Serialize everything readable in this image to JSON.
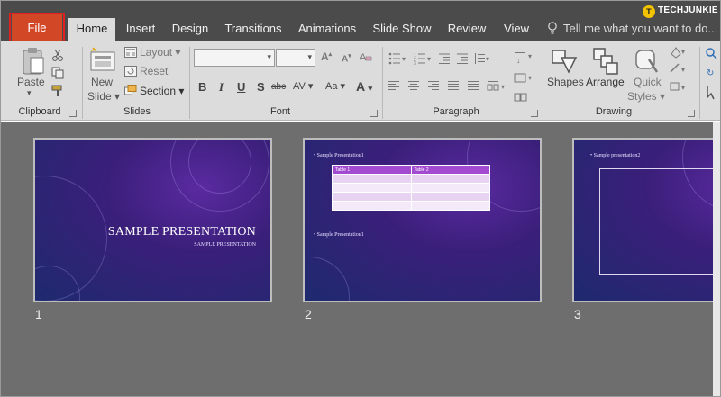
{
  "tabs": [
    "File",
    "Home",
    "Insert",
    "Design",
    "Transitions",
    "Animations",
    "Slide Show",
    "Review",
    "View"
  ],
  "tell_me": "Tell me what you want to do...",
  "watermark": "TECHJUNKIE",
  "watermark_letter": "T",
  "ribbon": {
    "clipboard": {
      "paste": "Paste",
      "label": "Clipboard"
    },
    "slides": {
      "new_slide_1": "New",
      "new_slide_2": "Slide",
      "layout": "Layout",
      "reset": "Reset",
      "section": "Section",
      "label": "Slides"
    },
    "font": {
      "label": "Font",
      "bold": "B",
      "italic": "I",
      "underline": "U",
      "strike": "S",
      "abc": "abc",
      "font_color": "A"
    },
    "paragraph": {
      "label": "Paragraph"
    },
    "drawing": {
      "shapes": "Shapes",
      "arrange": "Arrange",
      "quick_styles_1": "Quick",
      "quick_styles_2": "Styles",
      "label": "Drawing"
    }
  },
  "slides": [
    {
      "number": "1",
      "title": "SAMPLE PRESENTATION",
      "subtitle": "SAMPLE PRESENTATION"
    },
    {
      "number": "2",
      "bullet_top": "Sample Presentation1",
      "table_headers": [
        "Table 1",
        "Table 2"
      ],
      "bullet_bottom": "Sample Presentation1"
    },
    {
      "number": "3",
      "bullet_top": "Sample presentation2"
    }
  ],
  "colors": {
    "file_tab": "#d24726",
    "tab_bar": "#4b4b4b",
    "ribbon": "#dcdcdc",
    "sorter": "#6e6e6e",
    "highlight": "#e02020"
  }
}
